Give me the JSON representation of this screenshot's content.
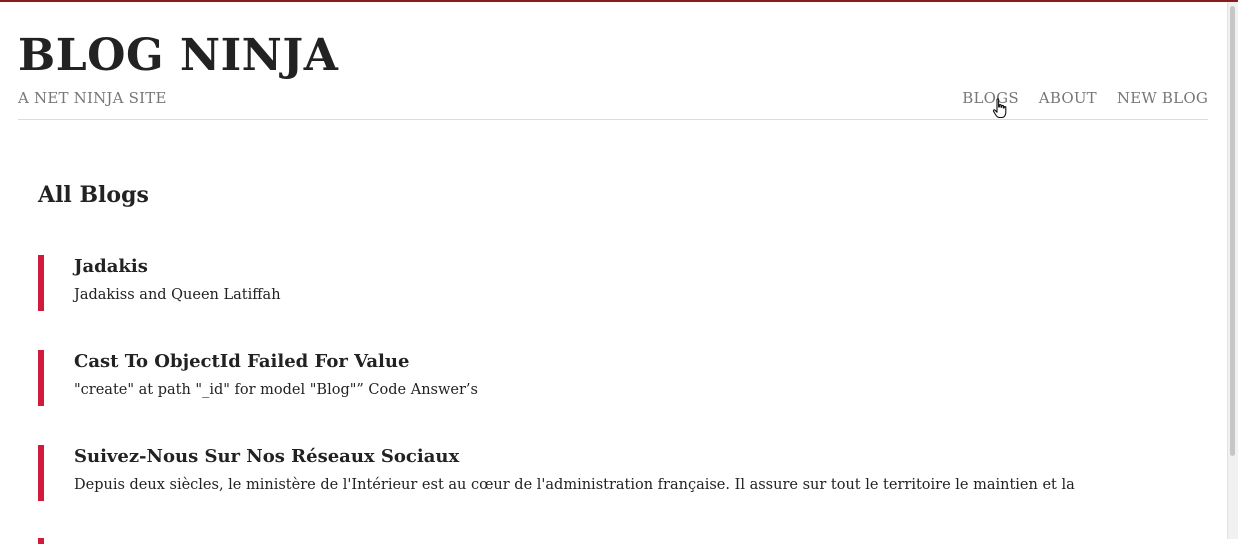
{
  "header": {
    "site_title": "BLOG NINJA",
    "site_subtitle": "A NET NINJA SITE",
    "nav": [
      "BLOGS",
      "ABOUT",
      "NEW BLOG"
    ]
  },
  "main": {
    "heading": "All Blogs",
    "blogs": [
      {
        "title": "Jadakis",
        "snippet": "Jadakiss and Queen Latiffah"
      },
      {
        "title": "Cast To ObjectId Failed For Value",
        "snippet": "\"create\" at path \"_id\" for model \"Blog\"” Code Answer’s"
      },
      {
        "title": "Suivez-Nous Sur Nos Réseaux Sociaux",
        "snippet": "Depuis deux siècles, le ministère de l'Intérieur est au cœur de l'administration française. Il assure sur tout le territoire le maintien et la"
      }
    ]
  },
  "colors": {
    "accent": "#d11a3c",
    "top_bar": "#8b1a1a",
    "muted_text": "#777777"
  },
  "icons": {
    "cursor": "hand-pointer-icon"
  }
}
